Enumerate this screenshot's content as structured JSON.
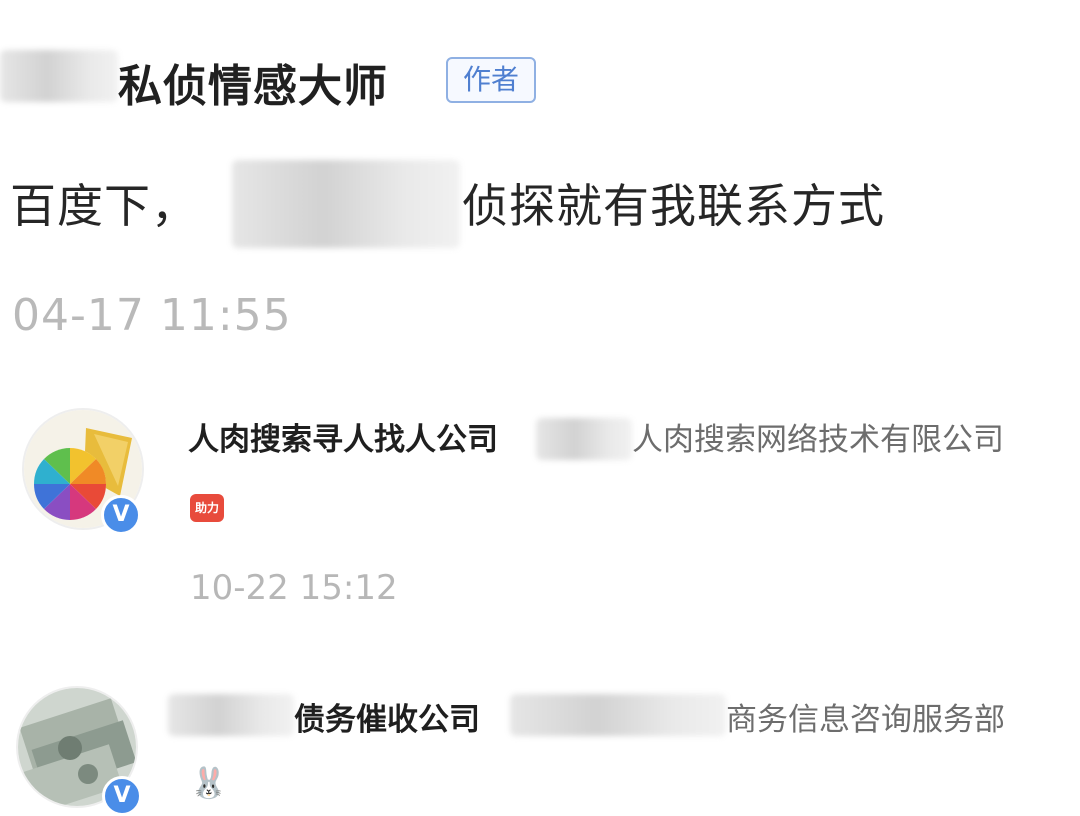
{
  "post": {
    "author_name": "私侦情感大师",
    "author_badge": "作者",
    "text_before": "百度下，",
    "text_after": "侦探就有我联系方式",
    "time": "04-17 11:55"
  },
  "comments": [
    {
      "name": "人肉搜索寻人找人公司",
      "text": "人肉搜索网络技术有限公司",
      "emoji_label": "助力",
      "time": "10-22 15:12",
      "verified_mark": "V"
    },
    {
      "name": "债务催收公司",
      "text": "商务信息咨询服务部",
      "emoji_label": "🐰",
      "verified_mark": "V"
    }
  ],
  "colors": {
    "badge_border": "#8fb0e3",
    "badge_text": "#4f7fd0",
    "verified": "#4a8de8",
    "time_gray": "#b9b9b9"
  }
}
